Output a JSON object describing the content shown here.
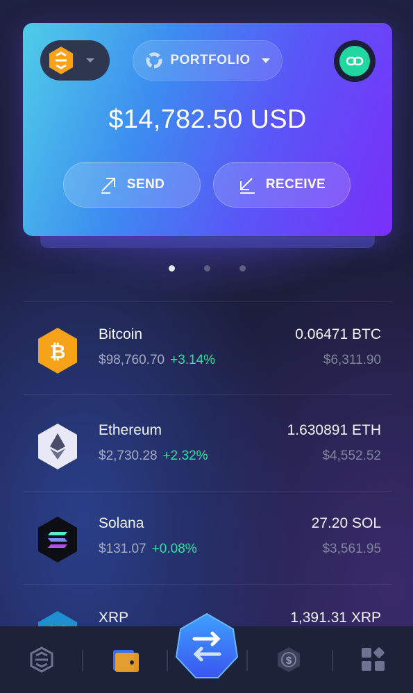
{
  "card": {
    "portfolio_label": "PORTFOLIO",
    "balance": "$14,782.50 USD",
    "send_label": "SEND",
    "receive_label": "RECEIVE"
  },
  "pager": {
    "count": 3,
    "active": 0
  },
  "assets": [
    {
      "name": "Bitcoin",
      "price": "$98,760.70",
      "change": "+3.14%",
      "amount": "0.06471 BTC",
      "value": "$6,311.90",
      "icon": "bitcoin-icon"
    },
    {
      "name": "Ethereum",
      "price": "$2,730.28",
      "change": "+2.32%",
      "amount": "1.630891 ETH",
      "value": "$4,552.52",
      "icon": "ethereum-icon"
    },
    {
      "name": "Solana",
      "price": "$131.07",
      "change": "+0.08%",
      "amount": "27.20 SOL",
      "value": "$3,561.95",
      "icon": "solana-icon"
    },
    {
      "name": "XRP",
      "price": "",
      "change": "",
      "amount": "1,391.31 XRP",
      "value": "",
      "icon": "xrp-icon"
    }
  ],
  "tabbar": {
    "items": [
      "exodus-logo-icon",
      "wallet-icon",
      "swap-icon",
      "staking-dollar-icon",
      "apps-grid-icon"
    ]
  },
  "colors": {
    "accent_green": "#2fe0a0",
    "card_gradient_start": "#4fcde8",
    "card_gradient_end": "#7a2ff8",
    "bitcoin_orange": "#f7a31a"
  }
}
